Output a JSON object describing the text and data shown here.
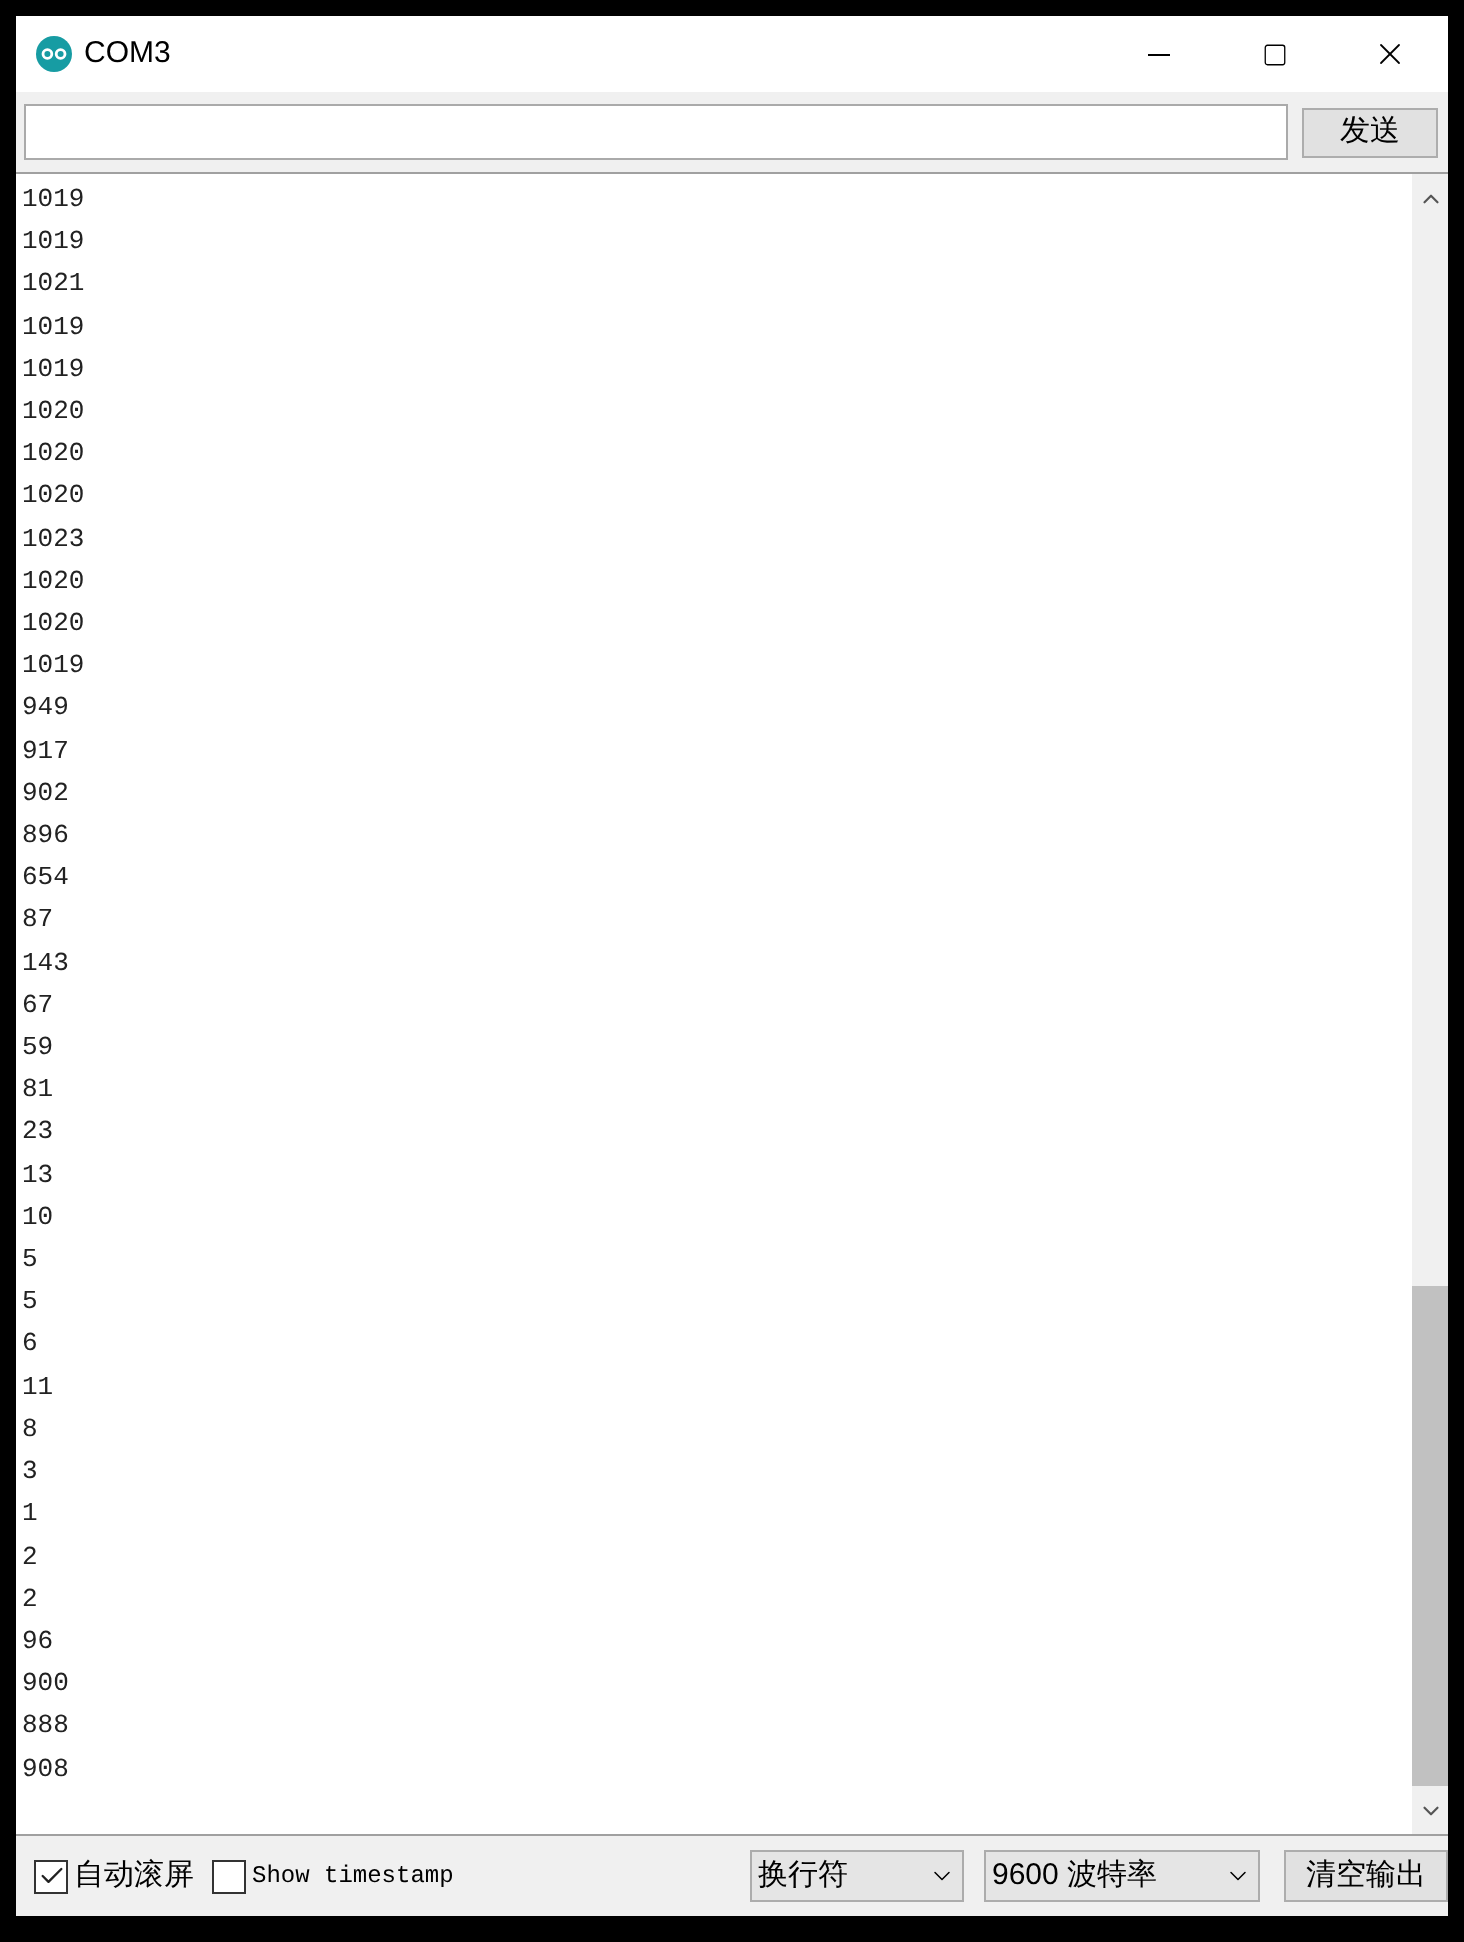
{
  "window": {
    "title": "COM3"
  },
  "send_bar": {
    "send_button": "发送"
  },
  "output_lines": [
    "1019",
    "1019",
    "1021",
    "1019",
    "1019",
    "1020",
    "1020",
    "1020",
    "1023",
    "1020",
    "1020",
    "1019",
    "949",
    "917",
    "902",
    "896",
    "654",
    "87",
    "143",
    "67",
    "59",
    "81",
    "23",
    "13",
    "10",
    "5",
    "5",
    "6",
    "11",
    "8",
    "3",
    "1",
    "2",
    "2",
    "96",
    "900",
    "888",
    "908"
  ],
  "bottom_bar": {
    "autoscroll": {
      "label": "自动滚屏",
      "checked": true
    },
    "timestamp": {
      "label": "Show timestamp",
      "checked": false
    },
    "line_ending": "换行符",
    "baud_rate": "9600 波特率",
    "clear_button": "清空输出"
  }
}
